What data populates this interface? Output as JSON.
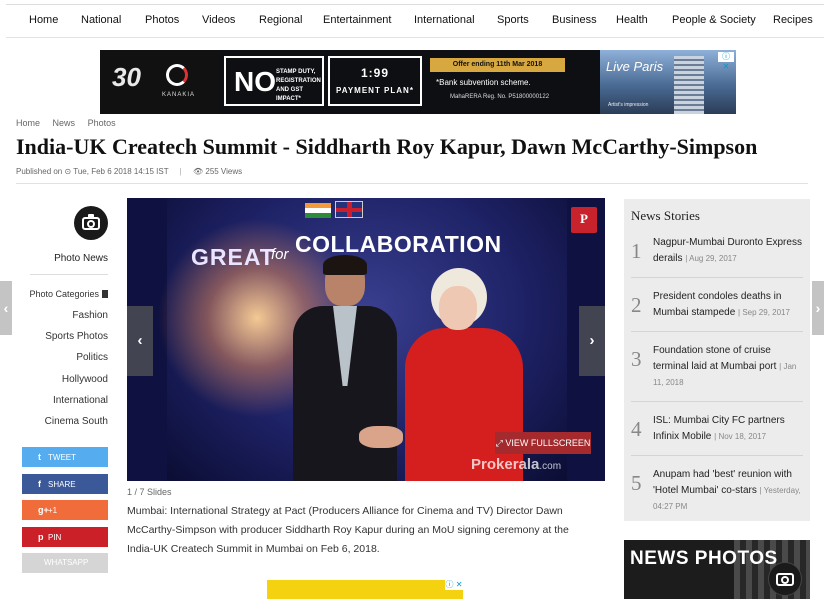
{
  "nav": {
    "items": [
      "Home",
      "National",
      "Photos",
      "Videos",
      "Regional",
      "Entertainment",
      "International",
      "Sports",
      "Business",
      "Health",
      "People & Society",
      "Recipes"
    ]
  },
  "ad": {
    "years": "30",
    "brand": "KANAKIA",
    "no_big": "NO",
    "no_small": "STAMP DUTY, REGISTRATION AND GST IMPACT*",
    "ratio": "1:99",
    "plan": "PAYMENT PLAN*",
    "offer": "Offer ending 11th Mar 2018",
    "bank": "*Bank subvention scheme.",
    "rera": "MahaRERA Reg. No. P51800000122",
    "live": "Live Paris",
    "impression": "Artist's impression",
    "close": "ⓘ ✕"
  },
  "breadcrumb": [
    "Home",
    "News",
    "Photos"
  ],
  "page_title": "India-UK Createch Summit - Siddharth Roy Kapur, Dawn McCarthy-Simpson",
  "meta": {
    "published": "Published on ⊙ Tue, Feb 6 2018 14:15 IST",
    "sep": "|",
    "views": "👁 255 Views"
  },
  "sidebar": {
    "photo_news": "Photo News",
    "categories_label": "Photo Categories",
    "categories": [
      "Fashion",
      "Sports Photos",
      "Politics",
      "Hollywood",
      "International",
      "Cinema South"
    ]
  },
  "share": [
    {
      "icon": "t",
      "label": "TWEET",
      "color": "#55acee"
    },
    {
      "icon": "f",
      "label": "SHARE",
      "color": "#3b5998"
    },
    {
      "icon": "g+",
      "label": "+1",
      "color": "#f06c3a"
    },
    {
      "icon": "p",
      "label": "PIN",
      "color": "#cb2027"
    },
    {
      "icon": "",
      "label": "WHATSAPP",
      "color": "#d5d5d5"
    }
  ],
  "photo": {
    "great": "GREAT",
    "for": "for",
    "collab": "COLLABORATION",
    "watermark": "Prokerala",
    "watermark_suffix": ".com",
    "fullscreen": "⤢ VIEW FULLSCREEN",
    "prev": "‹",
    "next": "›"
  },
  "slides": "1 / 7 Slides",
  "caption": "Mumbai: International Strategy at Pact (Producers Alliance for Cinema and TV) Director Dawn McCarthy-Simpson with producer Siddharth Roy Kapur during an MoU signing ceremony at the India-UK Createch Summit in Mumbai on Feb 6, 2018.",
  "edge": {
    "left": "‹",
    "right": "›"
  },
  "stories": {
    "title": "News Stories",
    "items": [
      {
        "n": "1",
        "title": "Nagpur-Mumbai Duronto Express derails",
        "date": "| Aug 29, 2017"
      },
      {
        "n": "2",
        "title": "President condoles deaths in Mumbai stampede",
        "date": "| Sep 29, 2017"
      },
      {
        "n": "3",
        "title": "Foundation stone of cruise terminal laid at Mumbai port",
        "date": "| Jan 11, 2018"
      },
      {
        "n": "4",
        "title": "ISL: Mumbai City FC partners Infinix Mobile",
        "date": "| Nov 18, 2017"
      },
      {
        "n": "5",
        "title": "Anupam had 'best' reunion with 'Hotel Mumbai' co-stars",
        "date": "| Yesterday, 04:27 PM"
      }
    ]
  },
  "news_photos": {
    "news": "NEWS",
    "photos": "PHOTOS"
  },
  "ad_bottom_close": "ⓘ ✕"
}
